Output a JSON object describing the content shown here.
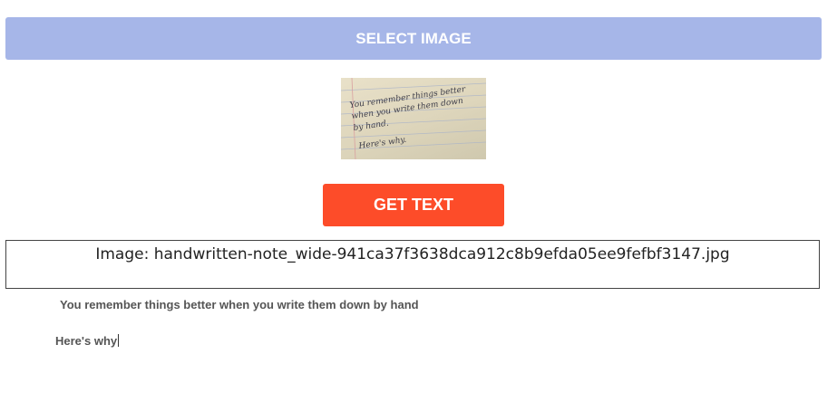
{
  "select_button": {
    "label": "SELECT IMAGE",
    "color": "#a6b6e8"
  },
  "thumbnail": {
    "handwriting_lines": [
      "You remember things better",
      "when you write them down",
      "by hand.",
      "Here's why."
    ]
  },
  "get_text_button": {
    "label": "GET TEXT",
    "color": "#fd4c29"
  },
  "result": {
    "file_label": "Image: handwritten-note_wide-941ca37f3638dca912c8b9efda05ee9fefbf3147.jpg"
  },
  "output_text": {
    "line1": "You remember things better when you write them down by hand",
    "line2": "Here's why"
  }
}
